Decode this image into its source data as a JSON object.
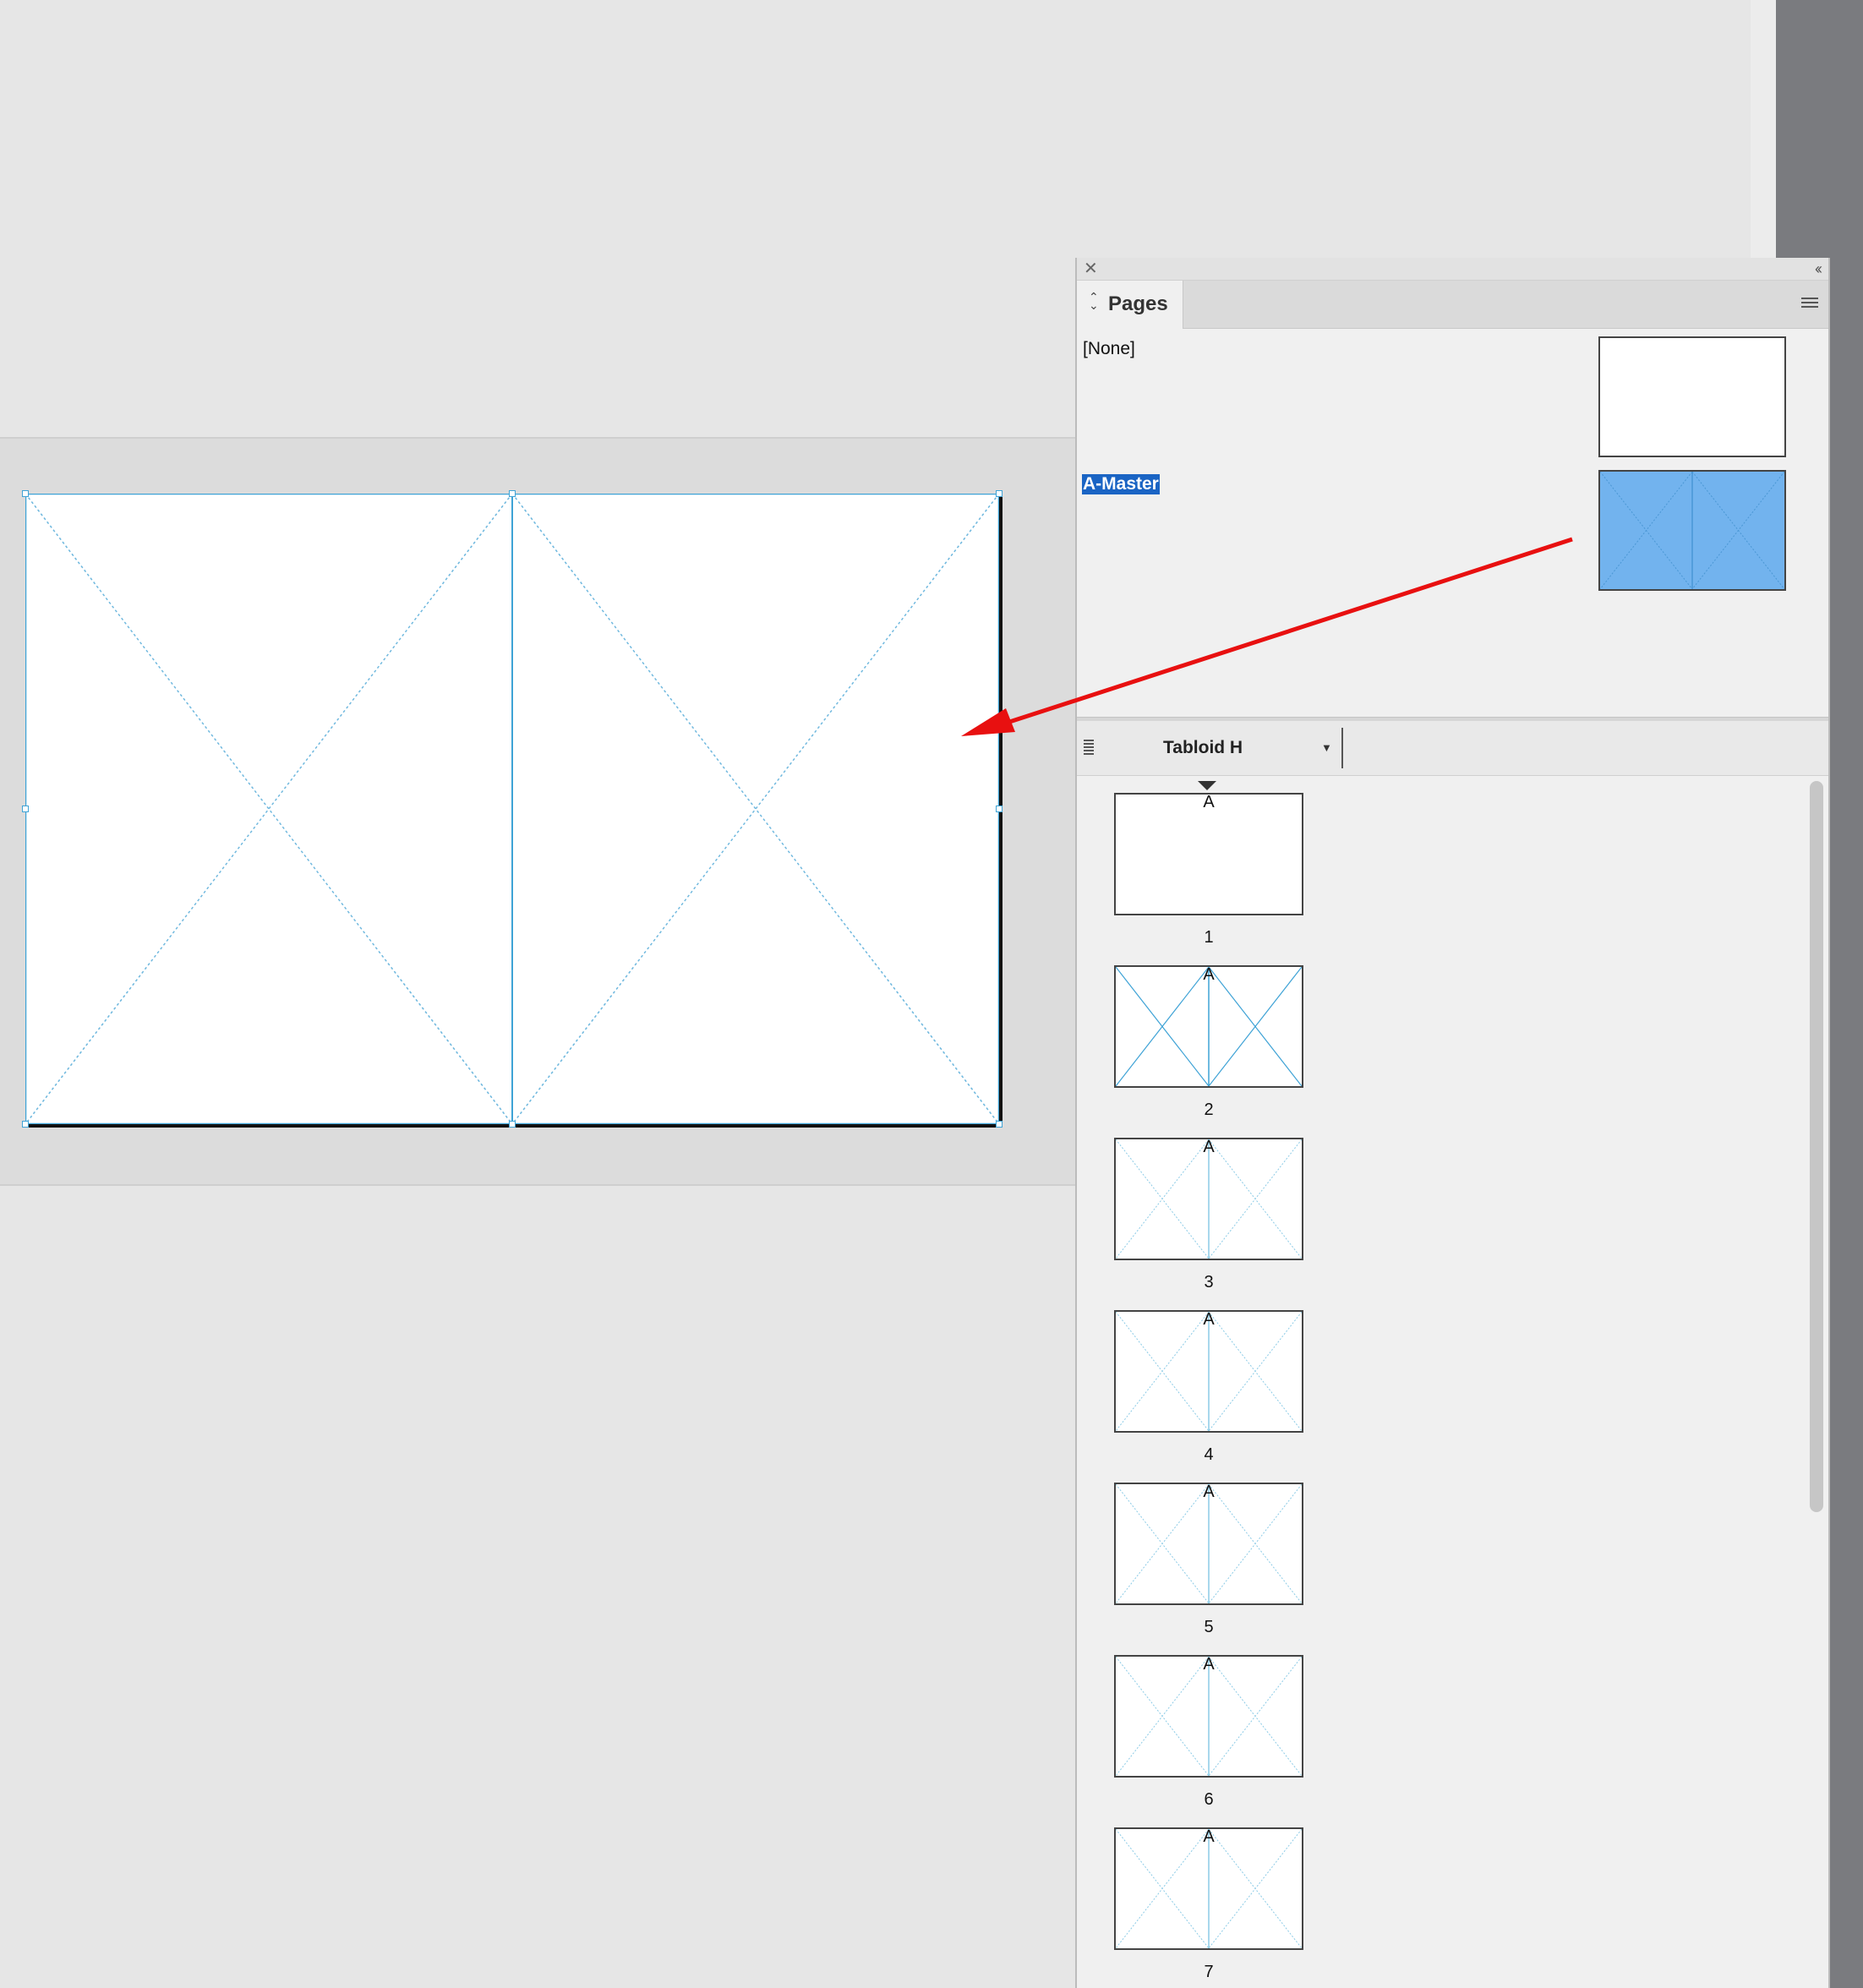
{
  "panel": {
    "tab_label": "Pages",
    "masters": [
      {
        "name": "[None]",
        "selected": false
      },
      {
        "name": "A-Master",
        "selected": true
      }
    ],
    "page_size": "Tabloid H",
    "pages": [
      {
        "number": "1",
        "master": "A"
      },
      {
        "number": "2",
        "master": "A"
      },
      {
        "number": "3",
        "master": "A"
      },
      {
        "number": "4",
        "master": "A"
      },
      {
        "number": "5",
        "master": "A"
      },
      {
        "number": "6",
        "master": "A"
      },
      {
        "number": "7",
        "master": "A"
      }
    ]
  },
  "colors": {
    "selection": "#1a64c4",
    "master_thumb": "#72b3ee",
    "guide": "#3fa3d6",
    "annotation_arrow": "#e81010"
  }
}
